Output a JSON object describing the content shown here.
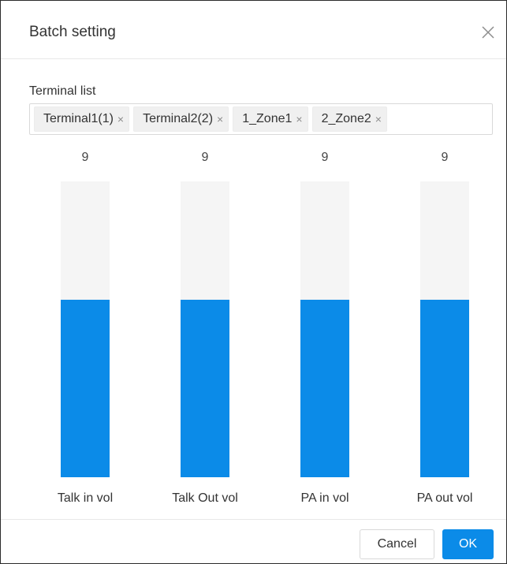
{
  "dialog": {
    "title": "Batch setting",
    "close_icon": "close-icon"
  },
  "terminal_list": {
    "label": "Terminal list",
    "tags": [
      {
        "label": "Terminal1(1)",
        "remove": "×"
      },
      {
        "label": "Terminal2(2)",
        "remove": "×"
      },
      {
        "label": "1_Zone1",
        "remove": "×"
      },
      {
        "label": "2_Zone2",
        "remove": "×"
      }
    ]
  },
  "sliders": [
    {
      "label": "Talk in vol",
      "value": "9",
      "fill_fraction": 0.6
    },
    {
      "label": "Talk Out vol",
      "value": "9",
      "fill_fraction": 0.6
    },
    {
      "label": "PA in vol",
      "value": "9",
      "fill_fraction": 0.6
    },
    {
      "label": "PA out vol",
      "value": "9",
      "fill_fraction": 0.6
    }
  ],
  "footer": {
    "cancel_label": "Cancel",
    "ok_label": "OK"
  },
  "colors": {
    "accent": "#0b8be8",
    "track": "#f5f5f5"
  }
}
